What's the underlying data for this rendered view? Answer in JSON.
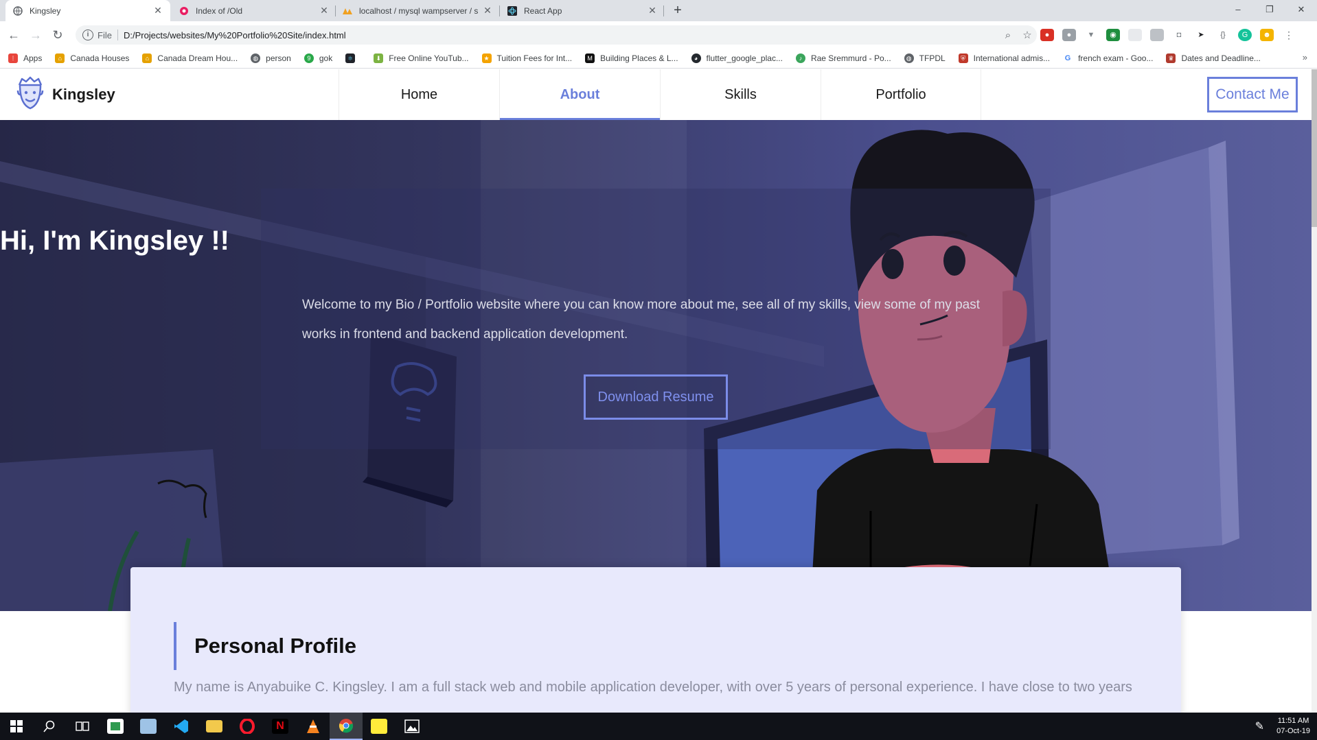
{
  "browser": {
    "tabs": [
      {
        "title": "Kingsley",
        "active": true,
        "icon": "globe-icon"
      },
      {
        "title": "Index of /Old",
        "active": false,
        "icon": "pma-icon"
      },
      {
        "title": "localhost / mysql wampserver / s",
        "active": false,
        "icon": "phpmyadmin-icon"
      },
      {
        "title": "React App",
        "active": false,
        "icon": "react-icon"
      }
    ],
    "new_tab_label": "+",
    "window_controls": {
      "minimize": "–",
      "maximize": "❐",
      "close": "✕"
    },
    "address": {
      "scheme_label": "File",
      "url": "D:/Projects/websites/My%20Portfolio%20Site/index.html"
    },
    "bookmarks": [
      {
        "label": "Apps",
        "icon": "apps-grid-icon",
        "color": "#e8453c"
      },
      {
        "label": "Canada Houses",
        "icon": "house-icon",
        "color": "#e5a100"
      },
      {
        "label": "Canada Dream Hou...",
        "icon": "house-icon",
        "color": "#e5a100"
      },
      {
        "label": "person",
        "icon": "globe-icon",
        "color": "#5f6368"
      },
      {
        "label": "gok",
        "icon": "nine-icon",
        "color": "#2aa84a"
      },
      {
        "label": "",
        "icon": "react-icon",
        "color": "#20232a"
      },
      {
        "label": "Free Online YouTub...",
        "icon": "download-arrow-icon",
        "color": "#7cb342"
      },
      {
        "label": "Tuition Fees for Int...",
        "icon": "star-badge-icon",
        "color": "#f4a300"
      },
      {
        "label": "Building Places & L...",
        "icon": "medium-icon",
        "color": "#111111"
      },
      {
        "label": "flutter_google_plac...",
        "icon": "github-icon",
        "color": "#24292e"
      },
      {
        "label": "Rae Sremmurd - Po...",
        "icon": "music-icon",
        "color": "#3ba55c"
      },
      {
        "label": "TFPDL",
        "icon": "globe-icon",
        "color": "#5f6368"
      },
      {
        "label": "International admis...",
        "icon": "shield-crest-icon",
        "color": "#c0392b"
      },
      {
        "label": "french exam - Goo...",
        "icon": "google-icon",
        "color": "#4285f4"
      },
      {
        "label": "Dates and Deadline...",
        "icon": "crest-icon",
        "color": "#b03a2e"
      }
    ],
    "bookmarks_more": "»"
  },
  "site": {
    "brand": "Kingsley",
    "nav": [
      {
        "label": "Home",
        "active": false
      },
      {
        "label": "About",
        "active": true
      },
      {
        "label": "Skills",
        "active": false
      },
      {
        "label": "Portfolio",
        "active": false
      }
    ],
    "contact_label": "Contact Me",
    "hero": {
      "title": "Hi, I'm Kingsley !!",
      "subtitle": "Welcome to my Bio / Portfolio website where you can know more about me, see all of my skills, view some of my past works in frontend and backend application development.",
      "cta": "Download Resume"
    },
    "profile": {
      "title": "Personal Profile",
      "text": "My name is Anyabuike C. Kingsley. I am a full stack web and mobile application developer, with over 5 years of personal experience. I have close to two years"
    },
    "colors": {
      "accent": "#6a7fdb",
      "hero_dark": "#262747",
      "hero_light": "#5a5f9c",
      "card_bg": "#e8e9fc"
    }
  },
  "taskbar": {
    "apps": [
      "windows-start-icon",
      "search-icon",
      "task-view-icon",
      "green-app-icon",
      "notepad-icon",
      "vscode-icon",
      "file-explorer-icon",
      "opera-icon",
      "netflix-icon",
      "vlc-icon",
      "chrome-icon",
      "sticky-notes-icon",
      "photos-icon"
    ],
    "time": "11:51 AM",
    "date": "07-Oct-19"
  }
}
